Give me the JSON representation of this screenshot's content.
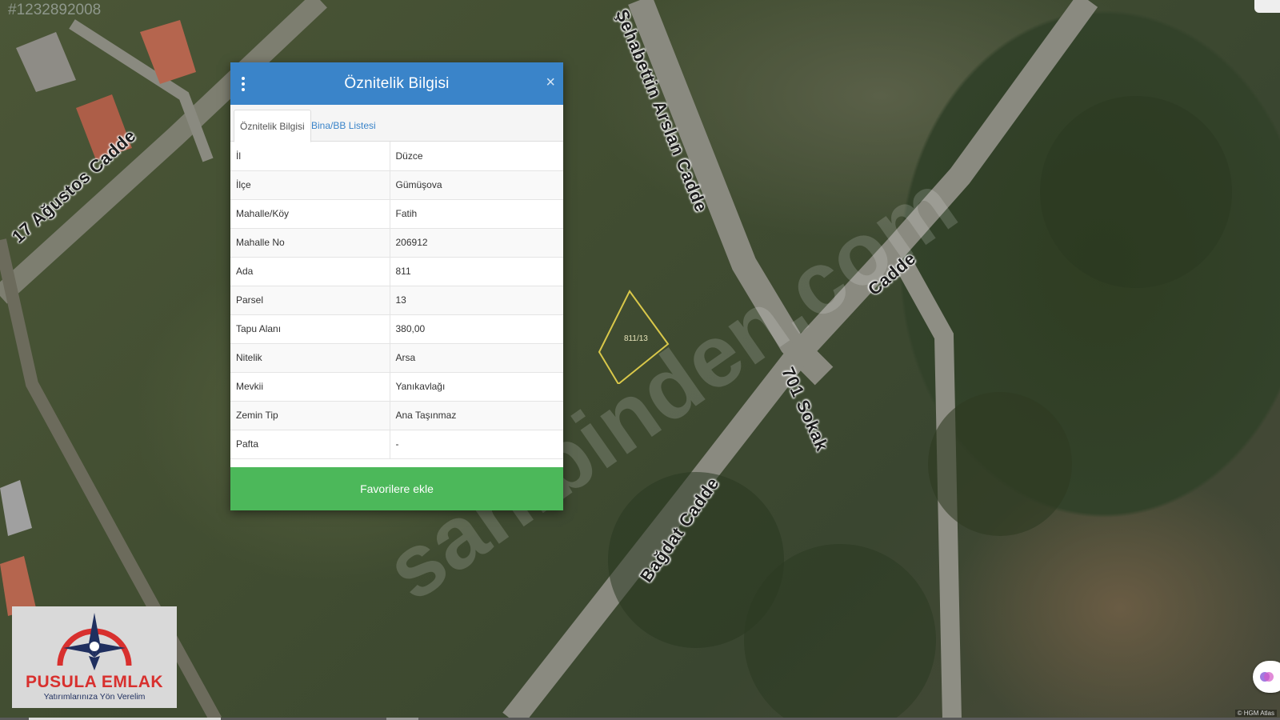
{
  "listing_id": "#1232892008",
  "watermark": "sahibinden.com",
  "parcel_label": "811/13",
  "roads": {
    "r1": "17 Ağustos Cadde",
    "r2": "Şehabettin Arslan Cadde",
    "r3": "701 Sokak",
    "r4": "Bağdat Cadde",
    "r5": "Cadde"
  },
  "dialog": {
    "title": "Öznitelik Bilgisi",
    "tabs": [
      "Öznitelik Bilgisi",
      "Bina/BB Listesi"
    ],
    "rows": [
      {
        "label": "İl",
        "value": "Düzce"
      },
      {
        "label": "İlçe",
        "value": "Gümüşova"
      },
      {
        "label": "Mahalle/Köy",
        "value": "Fatih"
      },
      {
        "label": "Mahalle No",
        "value": "206912"
      },
      {
        "label": "Ada",
        "value": "811"
      },
      {
        "label": "Parsel",
        "value": "13"
      },
      {
        "label": "Tapu Alanı",
        "value": "380,00"
      },
      {
        "label": "Nitelik",
        "value": "Arsa"
      },
      {
        "label": "Mevkii",
        "value": "Yanıkavlağı"
      },
      {
        "label": "Zemin Tip",
        "value": "Ana Taşınmaz"
      },
      {
        "label": "Pafta",
        "value": "-"
      }
    ],
    "favorite_button": "Favorilere ekle"
  },
  "logo": {
    "name": "PUSULA EMLAK",
    "slogan": "Yatırımlarınıza Yön Verelim"
  },
  "attribution": "© HGM Atlas",
  "colors": {
    "header": "#3a84c9",
    "favorite_button": "#4cb85a",
    "parcel_outline": "#d9c84a",
    "logo_red": "#d8302e",
    "logo_navy": "#1f2f5f"
  }
}
